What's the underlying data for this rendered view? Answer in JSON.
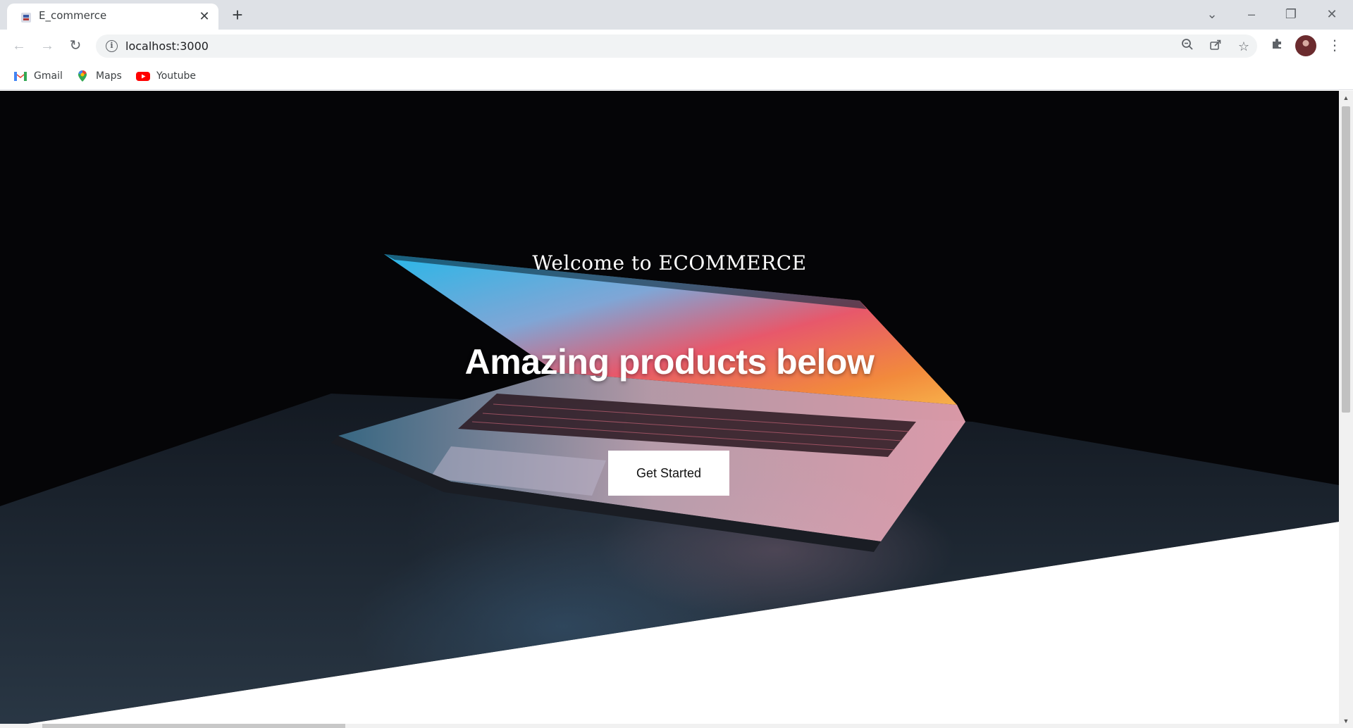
{
  "browser": {
    "tab": {
      "title": "E_commerce"
    },
    "url": "localhost:3000",
    "bookmarks": [
      {
        "label": "Gmail",
        "icon": "gmail-icon"
      },
      {
        "label": "Maps",
        "icon": "maps-icon"
      },
      {
        "label": "Youtube",
        "icon": "youtube-icon"
      }
    ]
  },
  "hero": {
    "welcome": "Welcome to ECOMMERCE",
    "headline": "Amazing products below",
    "cta_label": "Get Started",
    "background_color": "#050507"
  }
}
